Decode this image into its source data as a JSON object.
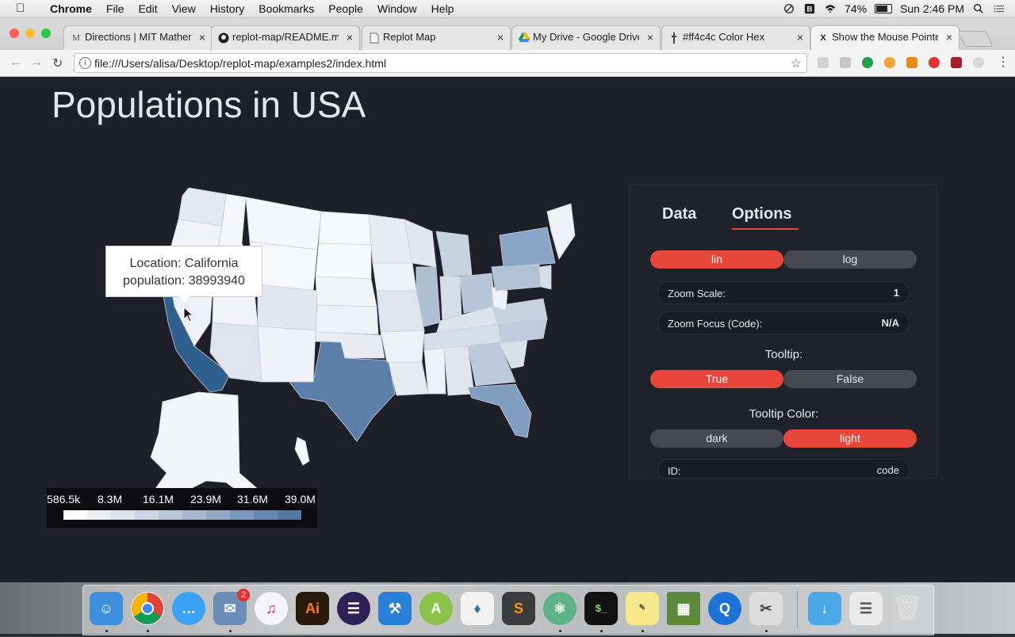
{
  "menubar": {
    "app": "Chrome",
    "items": [
      "File",
      "Edit",
      "View",
      "History",
      "Bookmarks",
      "People",
      "Window",
      "Help"
    ],
    "battery": "74%",
    "clock": "Sun 2:46 PM"
  },
  "tabs": [
    {
      "title": "Directions | MIT Mathem",
      "icon": "mit-icon"
    },
    {
      "title": "replot-map/README.md",
      "icon": "github-icon"
    },
    {
      "title": "Replot Map",
      "icon": "page-icon"
    },
    {
      "title": "My Drive - Google Drive",
      "icon": "drive-icon"
    },
    {
      "title": "#ff4c4c Color Hex",
      "icon": "color-icon"
    },
    {
      "title": "Show the Mouse Pointer",
      "icon": "x-icon"
    }
  ],
  "address": {
    "url": "file:///Users/alisa/Desktop/replot-map/examples2/index.html"
  },
  "page": {
    "title": "Populations in USA"
  },
  "tooltip": {
    "line1": "Location: California",
    "line2": "population: 38993940"
  },
  "legend": {
    "labels": [
      "586.5k",
      "8.3M",
      "16.1M",
      "23.9M",
      "31.6M",
      "39.0M"
    ],
    "colors": [
      "#ffffff",
      "#eceef2",
      "#dde2ea",
      "#ccd5e1",
      "#bac7d8",
      "#a7b8cf",
      "#92a8c5",
      "#7d97ba",
      "#6787af",
      "#5477a4"
    ]
  },
  "panel": {
    "tabs": {
      "data": "Data",
      "options": "Options"
    },
    "scale": {
      "lin": "lin",
      "log": "log",
      "selected": "lin"
    },
    "zoom_scale": {
      "label": "Zoom Scale:",
      "value": "1"
    },
    "zoom_focus": {
      "label": "Zoom Focus (Code):",
      "value": "N/A"
    },
    "tooltip": {
      "label": "Tooltip:",
      "true": "True",
      "false": "False",
      "selected": "True"
    },
    "tooltip_color": {
      "label": "Tooltip Color:",
      "dark": "dark",
      "light": "light",
      "selected": "light"
    },
    "id": {
      "label": "ID:",
      "value": "code"
    }
  },
  "colors": {
    "accent": "#e8453b",
    "page_bg": "#1e1f29",
    "highlight_state": "#2f5f8f"
  },
  "dock": {
    "mail_badge": "2"
  }
}
